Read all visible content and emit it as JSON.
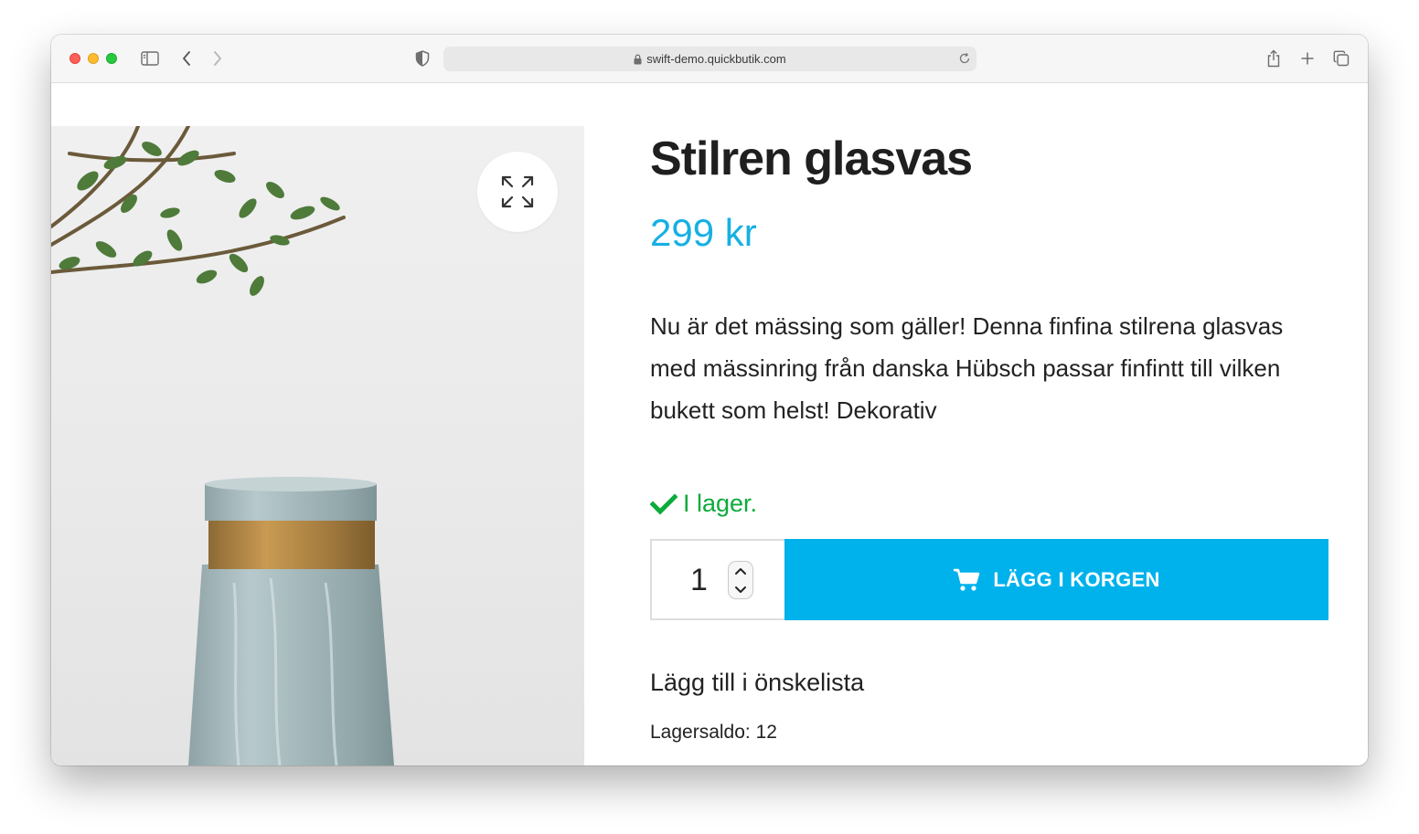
{
  "browser": {
    "url": "swift-demo.quickbutik.com"
  },
  "product": {
    "title": "Stilren glasvas",
    "price": "299 kr",
    "description": "Nu är det mässing som gäller! Denna finfina stilrena glasvas med mässinring från danska Hübsch passar finfintt till vilken bukett som helst! Dekorativ",
    "stock_status": "I lager.",
    "quantity": "1",
    "add_to_cart_label": "LÄGG I KORGEN",
    "wishlist_label": "Lägg till i önskelista",
    "stock_count": "Lagersaldo: 12"
  },
  "colors": {
    "accent": "#00b2ec",
    "price": "#16b0e3",
    "in_stock": "#0dab3b"
  },
  "icons": {
    "zoom": "expand-icon",
    "cart": "shopping-cart-icon",
    "stock": "checkmark-icon"
  }
}
